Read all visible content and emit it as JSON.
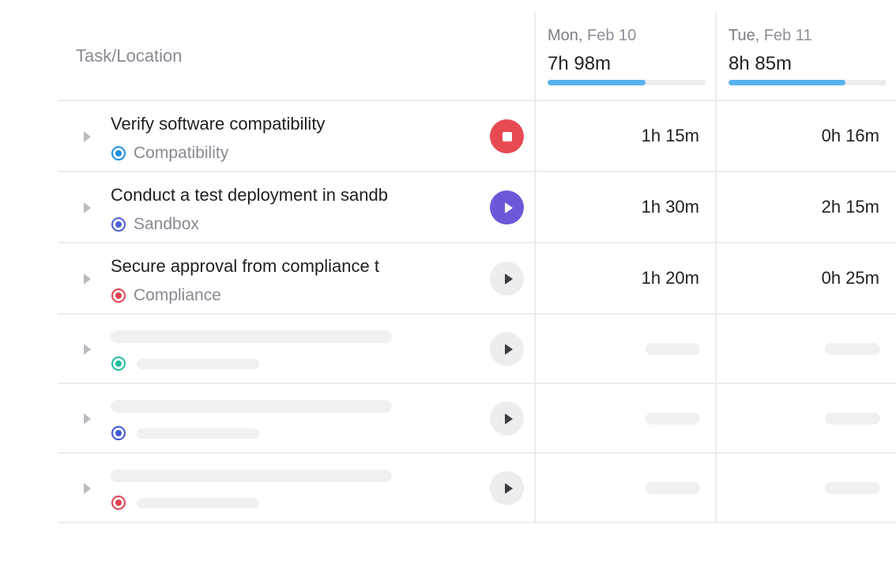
{
  "header": {
    "task_column_label": "Task/Location",
    "days": [
      {
        "dow": "Mon,",
        "date": "Feb 10",
        "total": "7h 98m",
        "progress": 0.62
      },
      {
        "dow": "Tue,",
        "date": "Feb 11",
        "total": "8h 85m",
        "progress": 0.74
      }
    ]
  },
  "tasks": [
    {
      "name": "Verify software compatibility",
      "location": "Compatibility",
      "location_color": "#1a8fe8",
      "timer_state": "stop",
      "timer_color": "#e84a52",
      "times": [
        "1h 15m",
        "0h 16m"
      ]
    },
    {
      "name": "Conduct a test deployment in sandb",
      "location": "Sandbox",
      "location_color": "#4a5fd6",
      "timer_state": "play-active",
      "timer_color": "#6d57d8",
      "times": [
        "1h 30m",
        "2h 15m"
      ]
    },
    {
      "name": "Secure approval from compliance t",
      "location": "Compliance",
      "location_color": "#e1434e",
      "timer_state": "play",
      "timer_color": "#ededef",
      "times": [
        "1h 20m",
        "0h 25m"
      ]
    }
  ],
  "placeholder_rows": [
    {
      "location_color": "#1ebfa0"
    },
    {
      "location_color": "#3f56d8"
    },
    {
      "location_color": "#e1434e"
    }
  ],
  "icons": {
    "expand": "caret-right-icon",
    "stop": "stop-icon",
    "play": "play-icon",
    "location": "location-dot-icon"
  }
}
